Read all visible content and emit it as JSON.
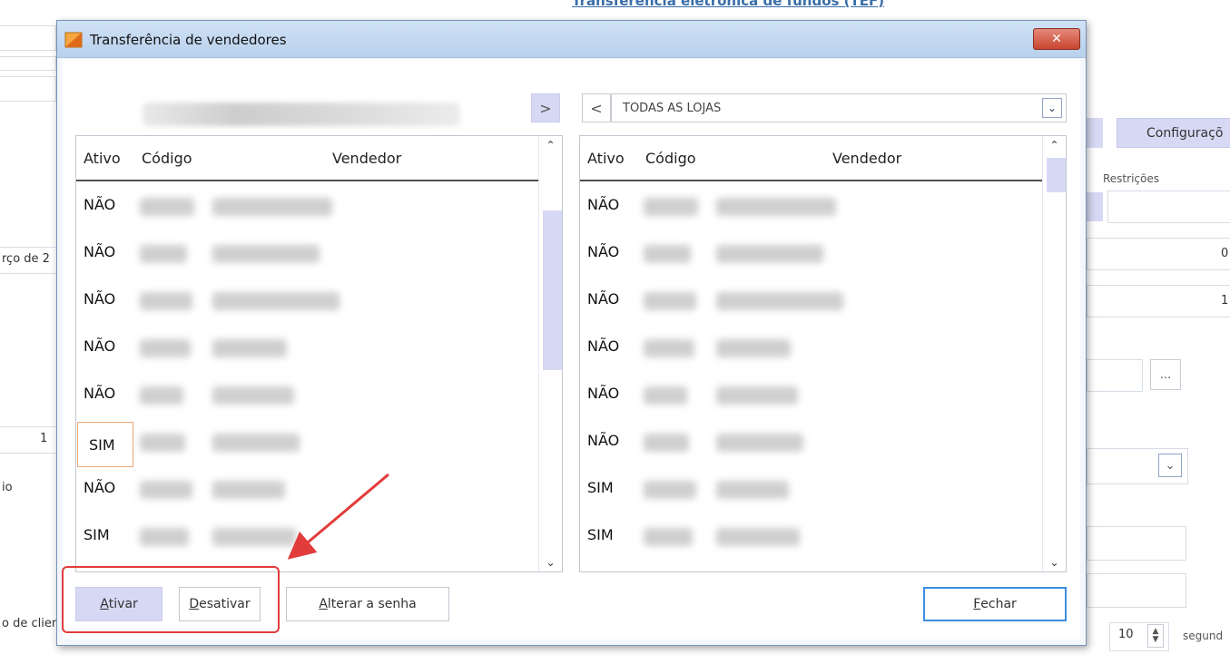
{
  "background": {
    "header_link": "Transferência eletrônica de fundos (TEF)",
    "config_button": "Configuraçõ",
    "restricoes_label": "Restrições",
    "left_label_1": "rço de 2",
    "left_value_1": "1",
    "left_label_2": "io",
    "left_label_3": "o de clien",
    "right_value_1": "0",
    "right_value_2": "1",
    "ellipsis_button": "...",
    "spin_value": "10",
    "seconds_label": "segund"
  },
  "dialog": {
    "title": "Transferência de vendedores",
    "close_label": "✕",
    "move_right_label": ">",
    "move_left_label": "<",
    "store_select_value": "TODAS AS LOJAS",
    "columns": [
      "Ativo",
      "Código",
      "Vendedor"
    ],
    "left_rows": [
      {
        "ativo": "NÃO"
      },
      {
        "ativo": "NÃO"
      },
      {
        "ativo": "NÃO"
      },
      {
        "ativo": "NÃO"
      },
      {
        "ativo": "NÃO"
      },
      {
        "ativo": "SIM"
      },
      {
        "ativo": "NÃO"
      },
      {
        "ativo": "SIM"
      }
    ],
    "right_rows": [
      {
        "ativo": "NÃO"
      },
      {
        "ativo": "NÃO"
      },
      {
        "ativo": "NÃO"
      },
      {
        "ativo": "NÃO"
      },
      {
        "ativo": "NÃO"
      },
      {
        "ativo": "NÃO"
      },
      {
        "ativo": "SIM"
      },
      {
        "ativo": "SIM"
      }
    ],
    "buttons": {
      "ativar": {
        "first": "A",
        "rest": "tivar"
      },
      "desativar": {
        "first": "D",
        "rest": "esativar"
      },
      "alterar_senha": {
        "first": "A",
        "rest": "lterar a senha"
      },
      "fechar": {
        "first": "F",
        "rest": "echar"
      }
    }
  },
  "colors": {
    "highlight": "#e23b3b",
    "selection_fill": "#d7d9f4",
    "default_button_border": "#3b8ee0"
  }
}
